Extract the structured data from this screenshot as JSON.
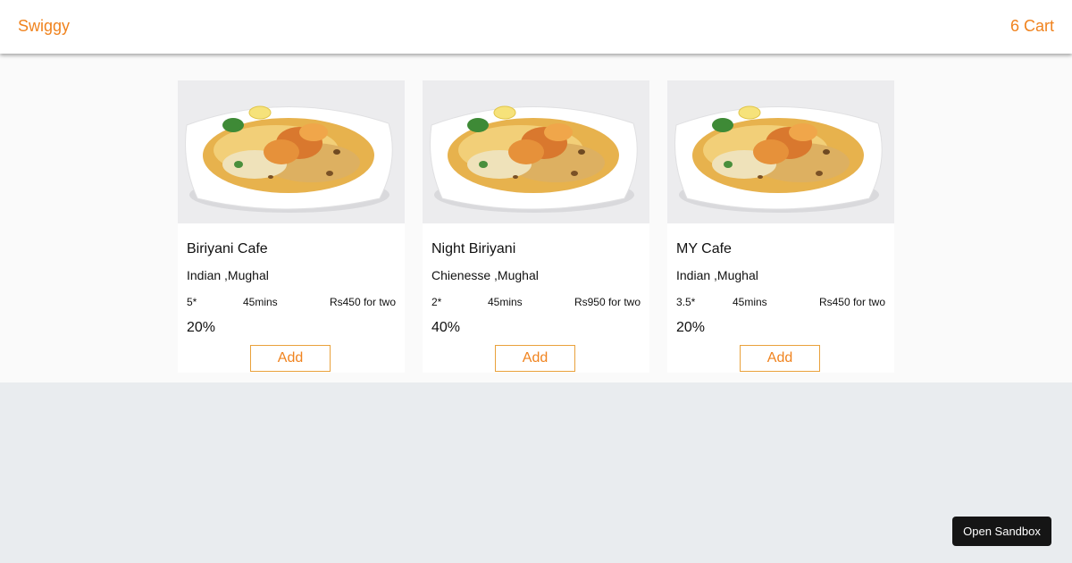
{
  "header": {
    "brand": "Swiggy",
    "cart_label": "6 Cart"
  },
  "restaurants": [
    {
      "name": "Biriyani Cafe",
      "cuisine": "Indian ,Mughal",
      "rating": "5*",
      "time": "45mins",
      "price": "Rs450 for two",
      "offer": "20%",
      "add_label": "Add"
    },
    {
      "name": "Night Biriyani",
      "cuisine": "Chienesse ,Mughal",
      "rating": "2*",
      "time": "45mins",
      "price": "Rs950 for two",
      "offer": "40%",
      "add_label": "Add"
    },
    {
      "name": "MY Cafe",
      "cuisine": "Indian ,Mughal",
      "rating": "3.5*",
      "time": "45mins",
      "price": "Rs450 for two",
      "offer": "20%",
      "add_label": "Add"
    }
  ],
  "sandbox_button": "Open Sandbox",
  "colors": {
    "accent": "#f0831e",
    "page_background": "#e9ecef",
    "content_background": "#fafafa",
    "sandbox_button": "#151515"
  }
}
